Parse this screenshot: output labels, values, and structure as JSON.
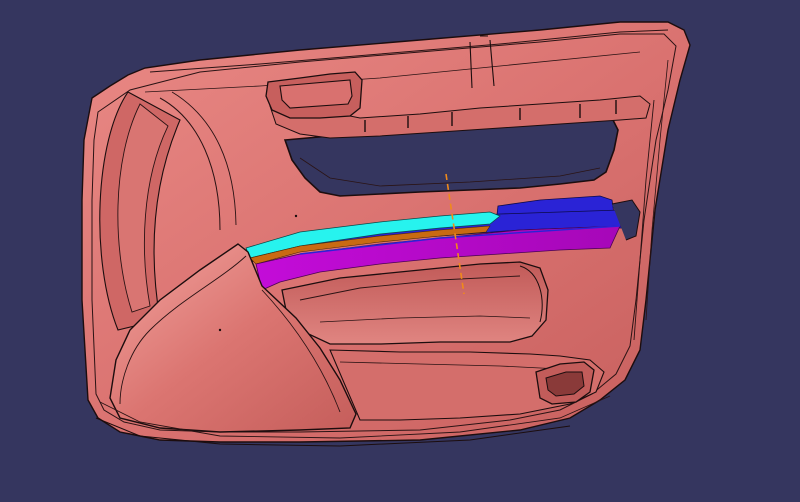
{
  "viewport": {
    "background": "#35365f",
    "model": "door-trim-panel",
    "colors": {
      "panel": "#d9716f",
      "panel_shade": "#b95655",
      "panel_highlight": "#ef9d98",
      "edge": "#1c0d0e",
      "trim_magenta": "#b209c4",
      "trim_blue": "#2a23d6",
      "trim_cyan": "#27f3ee",
      "trim_orange": "#c96a12",
      "axis_line": "#f08a1a"
    }
  }
}
